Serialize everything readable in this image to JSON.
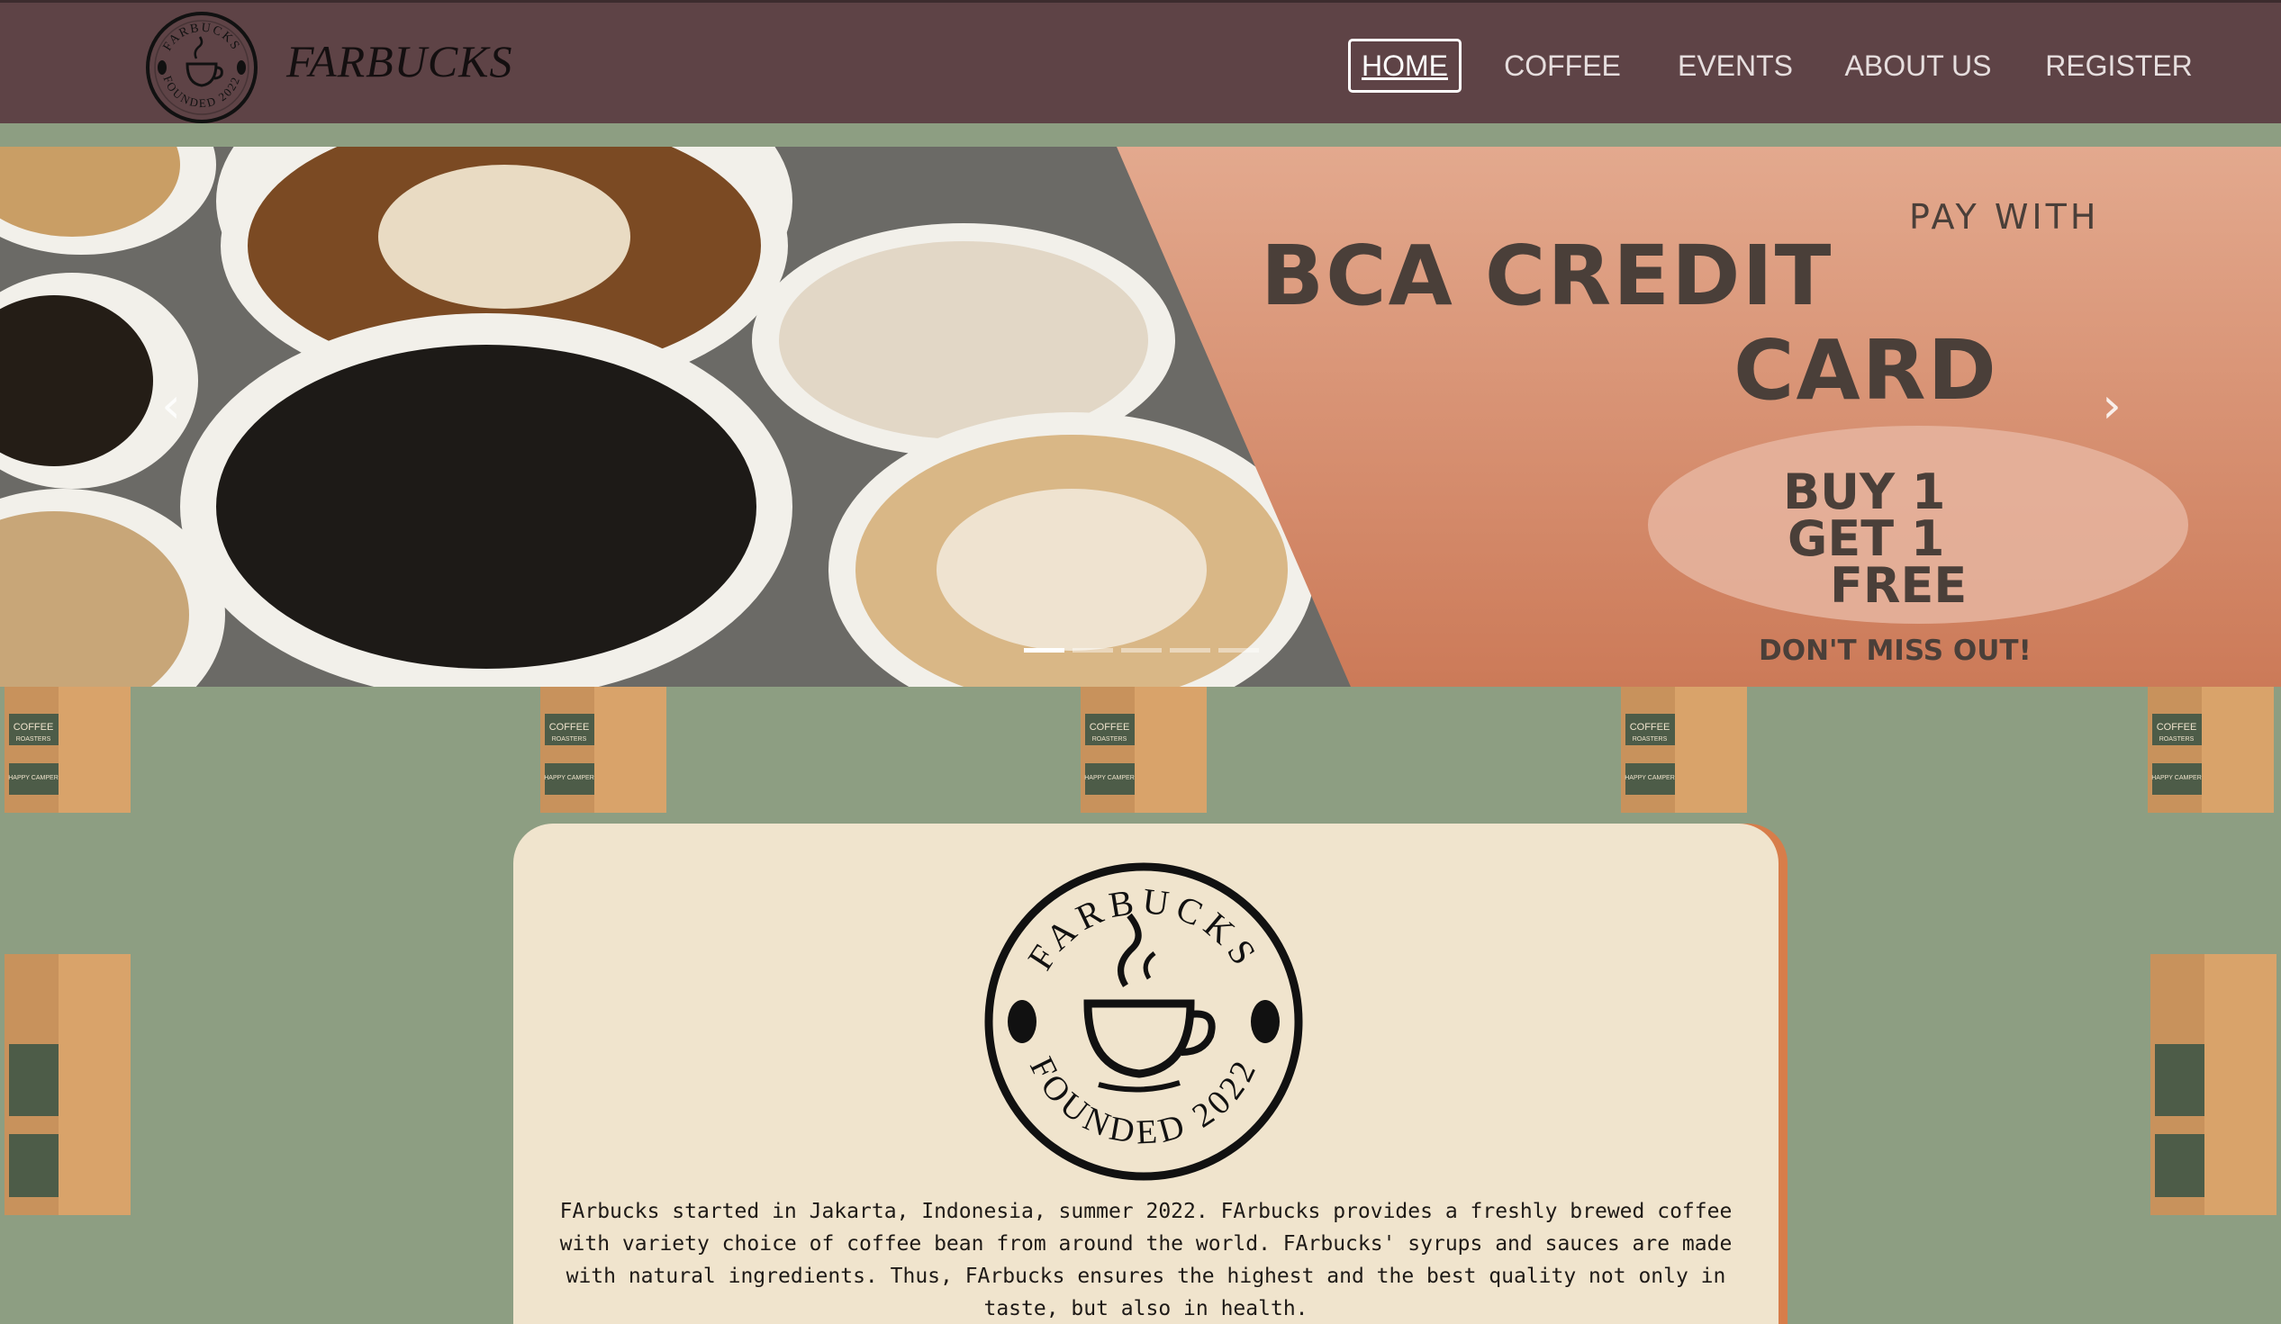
{
  "navbar": {
    "brand": "FARBUCKS",
    "logo_ring_top": "FARBUCKS",
    "logo_ring_bottom": "FOUNDED 2022",
    "items": [
      {
        "label": "HOME",
        "active": true
      },
      {
        "label": "COFFEE",
        "active": false
      },
      {
        "label": "EVENTS",
        "active": false
      },
      {
        "label": "ABOUT US",
        "active": false
      },
      {
        "label": "REGISTER",
        "active": false
      }
    ]
  },
  "carousel": {
    "promo": {
      "line1": "PAY WITH",
      "line2": "BCA CREDIT",
      "line3": "CARD",
      "offer1": "BUY 1",
      "offer2": "GET 1",
      "offer3": "FREE",
      "footer": "DON'T MISS OUT!"
    },
    "prev_icon": "chevron-left-icon",
    "next_icon": "chevron-right-icon",
    "slide_count": 5,
    "active_slide": 1
  },
  "pattern": {
    "bag_label_top": "COFFEE",
    "bag_label_sub": "ROASTERS",
    "bag_label_bottom": "HAPPY CAMPER"
  },
  "about": {
    "logo_ring_top": "FARBUCKS",
    "logo_ring_bottom": "FOUNDED 2022",
    "paragraph": "FArbucks started in Jakarta, Indonesia, summer 2022. FArbucks provides a freshly brewed coffee with variety choice of coffee bean from around the world. FArbucks' syrups and sauces are made with natural ingredients. Thus, FArbucks ensures the highest and the best quality not only in taste, but also in health."
  },
  "colors": {
    "navbar": "#5e4346",
    "background": "#8d9e82",
    "card": "#f0e4cd",
    "card_accent": "#d77d4a",
    "promo_bg": "#d99579"
  }
}
